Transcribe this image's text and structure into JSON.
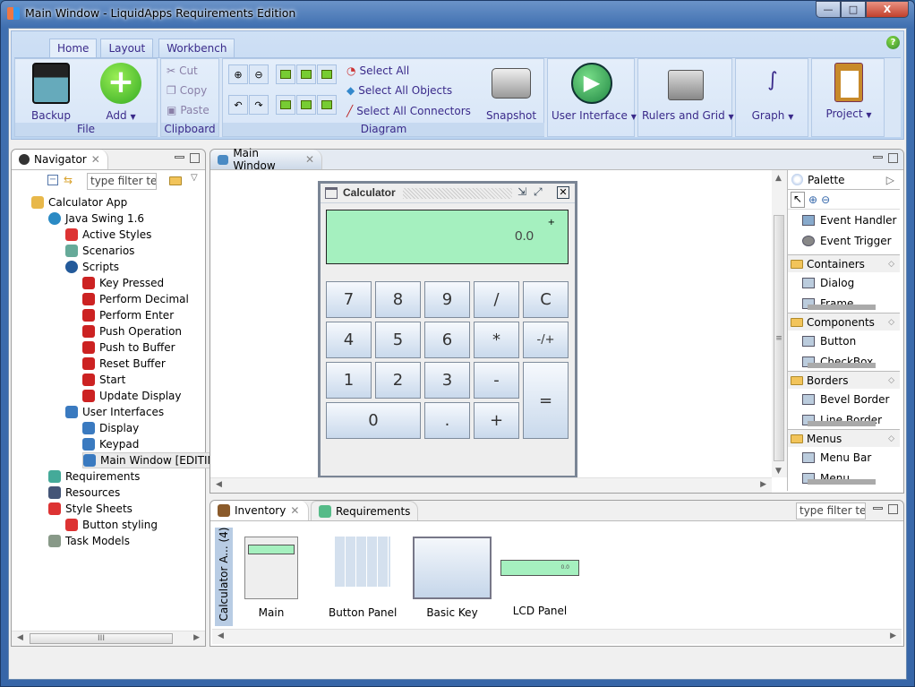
{
  "window": {
    "title": "Main Window - LiquidApps Requirements Edition",
    "min": "—",
    "max": "□",
    "close": "X"
  },
  "ribbon": {
    "tabs": [
      {
        "label": "Home"
      },
      {
        "label": "Layout"
      },
      {
        "label": "Workbench"
      }
    ],
    "help": "?",
    "file": {
      "label": "File",
      "backup": "Backup",
      "add": "Add"
    },
    "clipboard": {
      "label": "Clipboard",
      "cut": "Cut",
      "copy": "Copy",
      "paste": "Paste"
    },
    "diagram": {
      "label": "Diagram",
      "select_all": "Select All",
      "select_all_objects": "Select All Objects",
      "select_all_connectors": "Select All Connectors"
    },
    "snapshot": "Snapshot",
    "user_interface": "User Interface",
    "rulers_grid": "Rulers and Grid",
    "graph": "Graph",
    "project": "Project"
  },
  "navigator": {
    "title": "Navigator",
    "filter_placeholder": "type filter text",
    "tree": [
      {
        "label": "Calculator App",
        "level": 0,
        "icon": "folder"
      },
      {
        "label": "Java Swing 1.6",
        "level": 1,
        "icon": "java-swing"
      },
      {
        "label": "Active Styles",
        "level": 2,
        "icon": "styles"
      },
      {
        "label": "Scenarios",
        "level": 2,
        "icon": "scenarios"
      },
      {
        "label": "Scripts",
        "level": 2,
        "icon": "scripts"
      },
      {
        "label": "Key Pressed",
        "level": 3,
        "icon": "script"
      },
      {
        "label": "Perform Decimal",
        "level": 3,
        "icon": "script"
      },
      {
        "label": "Perform Enter",
        "level": 3,
        "icon": "script"
      },
      {
        "label": "Push Operation",
        "level": 3,
        "icon": "script"
      },
      {
        "label": "Push to Buffer",
        "level": 3,
        "icon": "script"
      },
      {
        "label": "Reset Buffer",
        "level": 3,
        "icon": "script"
      },
      {
        "label": "Start",
        "level": 3,
        "icon": "script"
      },
      {
        "label": "Update Display",
        "level": 3,
        "icon": "script"
      },
      {
        "label": "User Interfaces",
        "level": 2,
        "icon": "monitor"
      },
      {
        "label": "Display",
        "level": 3,
        "icon": "monitor"
      },
      {
        "label": "Keypad",
        "level": 3,
        "icon": "monitor"
      },
      {
        "label": "Main Window [EDITIN",
        "level": 3,
        "icon": "monitor",
        "selected": true
      },
      {
        "label": "Requirements",
        "level": 1,
        "icon": "requirements"
      },
      {
        "label": "Resources",
        "level": 1,
        "icon": "resources"
      },
      {
        "label": "Style Sheets",
        "level": 1,
        "icon": "styles"
      },
      {
        "label": "Button styling",
        "level": 2,
        "icon": "styles"
      },
      {
        "label": "Task Models",
        "level": 1,
        "icon": "task"
      }
    ]
  },
  "editor": {
    "tab": "Main Window",
    "calculator": {
      "title": "Calculator",
      "display": "0.0",
      "sign": "+",
      "keys": [
        "7",
        "8",
        "9",
        "/",
        "C",
        "4",
        "5",
        "6",
        "*",
        "-/+",
        "1",
        "2",
        "3",
        "-",
        "=",
        "0",
        ".",
        "+"
      ]
    }
  },
  "palette": {
    "title": "Palette",
    "tools": [
      "select",
      "zoom-in",
      "zoom-out"
    ],
    "items": [
      "Event Handler",
      "Event Trigger"
    ],
    "sections": [
      {
        "label": "Containers",
        "items": [
          "Dialog",
          "Frame"
        ]
      },
      {
        "label": "Components",
        "items": [
          "Button",
          "CheckBox"
        ]
      },
      {
        "label": "Borders",
        "items": [
          "Bevel Border",
          "Line Border"
        ]
      },
      {
        "label": "Menus",
        "items": [
          "Menu Bar",
          "Menu"
        ]
      }
    ]
  },
  "inventory": {
    "tabs": [
      {
        "label": "Inventory"
      },
      {
        "label": "Requirements"
      }
    ],
    "filter_placeholder": "type filter text",
    "group_label": "Calculator A... (4)",
    "items": [
      {
        "label": "Main"
      },
      {
        "label": "Button Panel"
      },
      {
        "label": "Basic Key"
      },
      {
        "label": "LCD Panel"
      }
    ],
    "lcd_value": "0.0"
  }
}
